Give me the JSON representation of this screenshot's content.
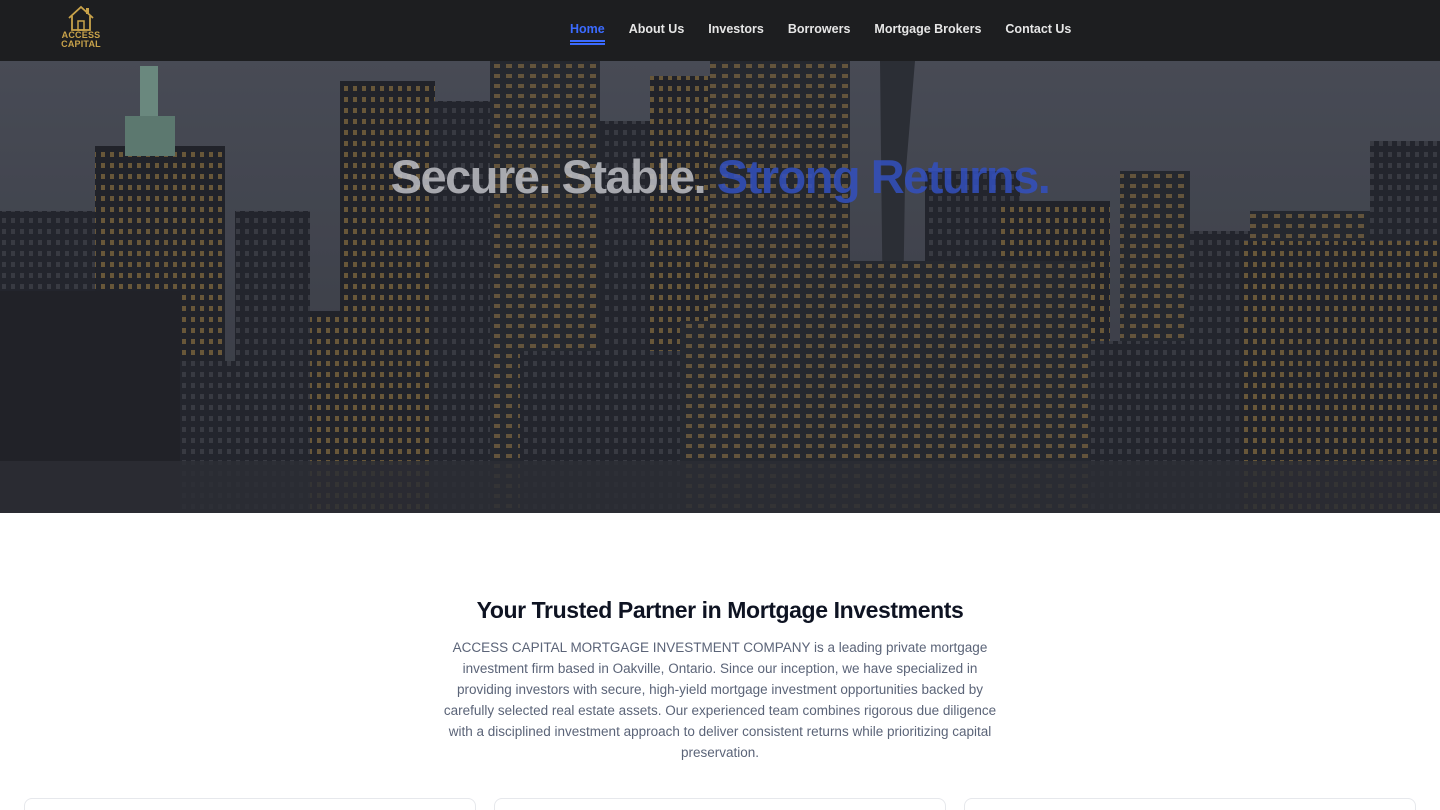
{
  "brand": {
    "logo_line1": "ACCESS",
    "logo_line2": "CAPITAL",
    "accent_color": "#3b6bff",
    "gold_color": "#c9a34a"
  },
  "nav": {
    "items": [
      {
        "label": "Home",
        "active": true
      },
      {
        "label": "About Us",
        "active": false
      },
      {
        "label": "Investors",
        "active": false
      },
      {
        "label": "Borrowers",
        "active": false
      },
      {
        "label": "Mortgage Brokers",
        "active": false
      },
      {
        "label": "Contact Us",
        "active": false
      }
    ]
  },
  "hero": {
    "title_plain": "Secure. Stable.",
    "title_accent": "Strong Returns.",
    "background": "night city skyline"
  },
  "about": {
    "title": "Your Trusted Partner in Mortgage Investments",
    "body": "ACCESS CAPITAL MORTGAGE INVESTMENT COMPANY is a leading private mortgage investment firm based in Oakville, Ontario. Since our inception, we have specialized in providing investors with secure, high-yield mortgage investment opportunities backed by carefully selected real estate assets. Our experienced team combines rigorous due diligence with a disciplined investment approach to deliver consistent returns while prioritizing capital preservation."
  }
}
